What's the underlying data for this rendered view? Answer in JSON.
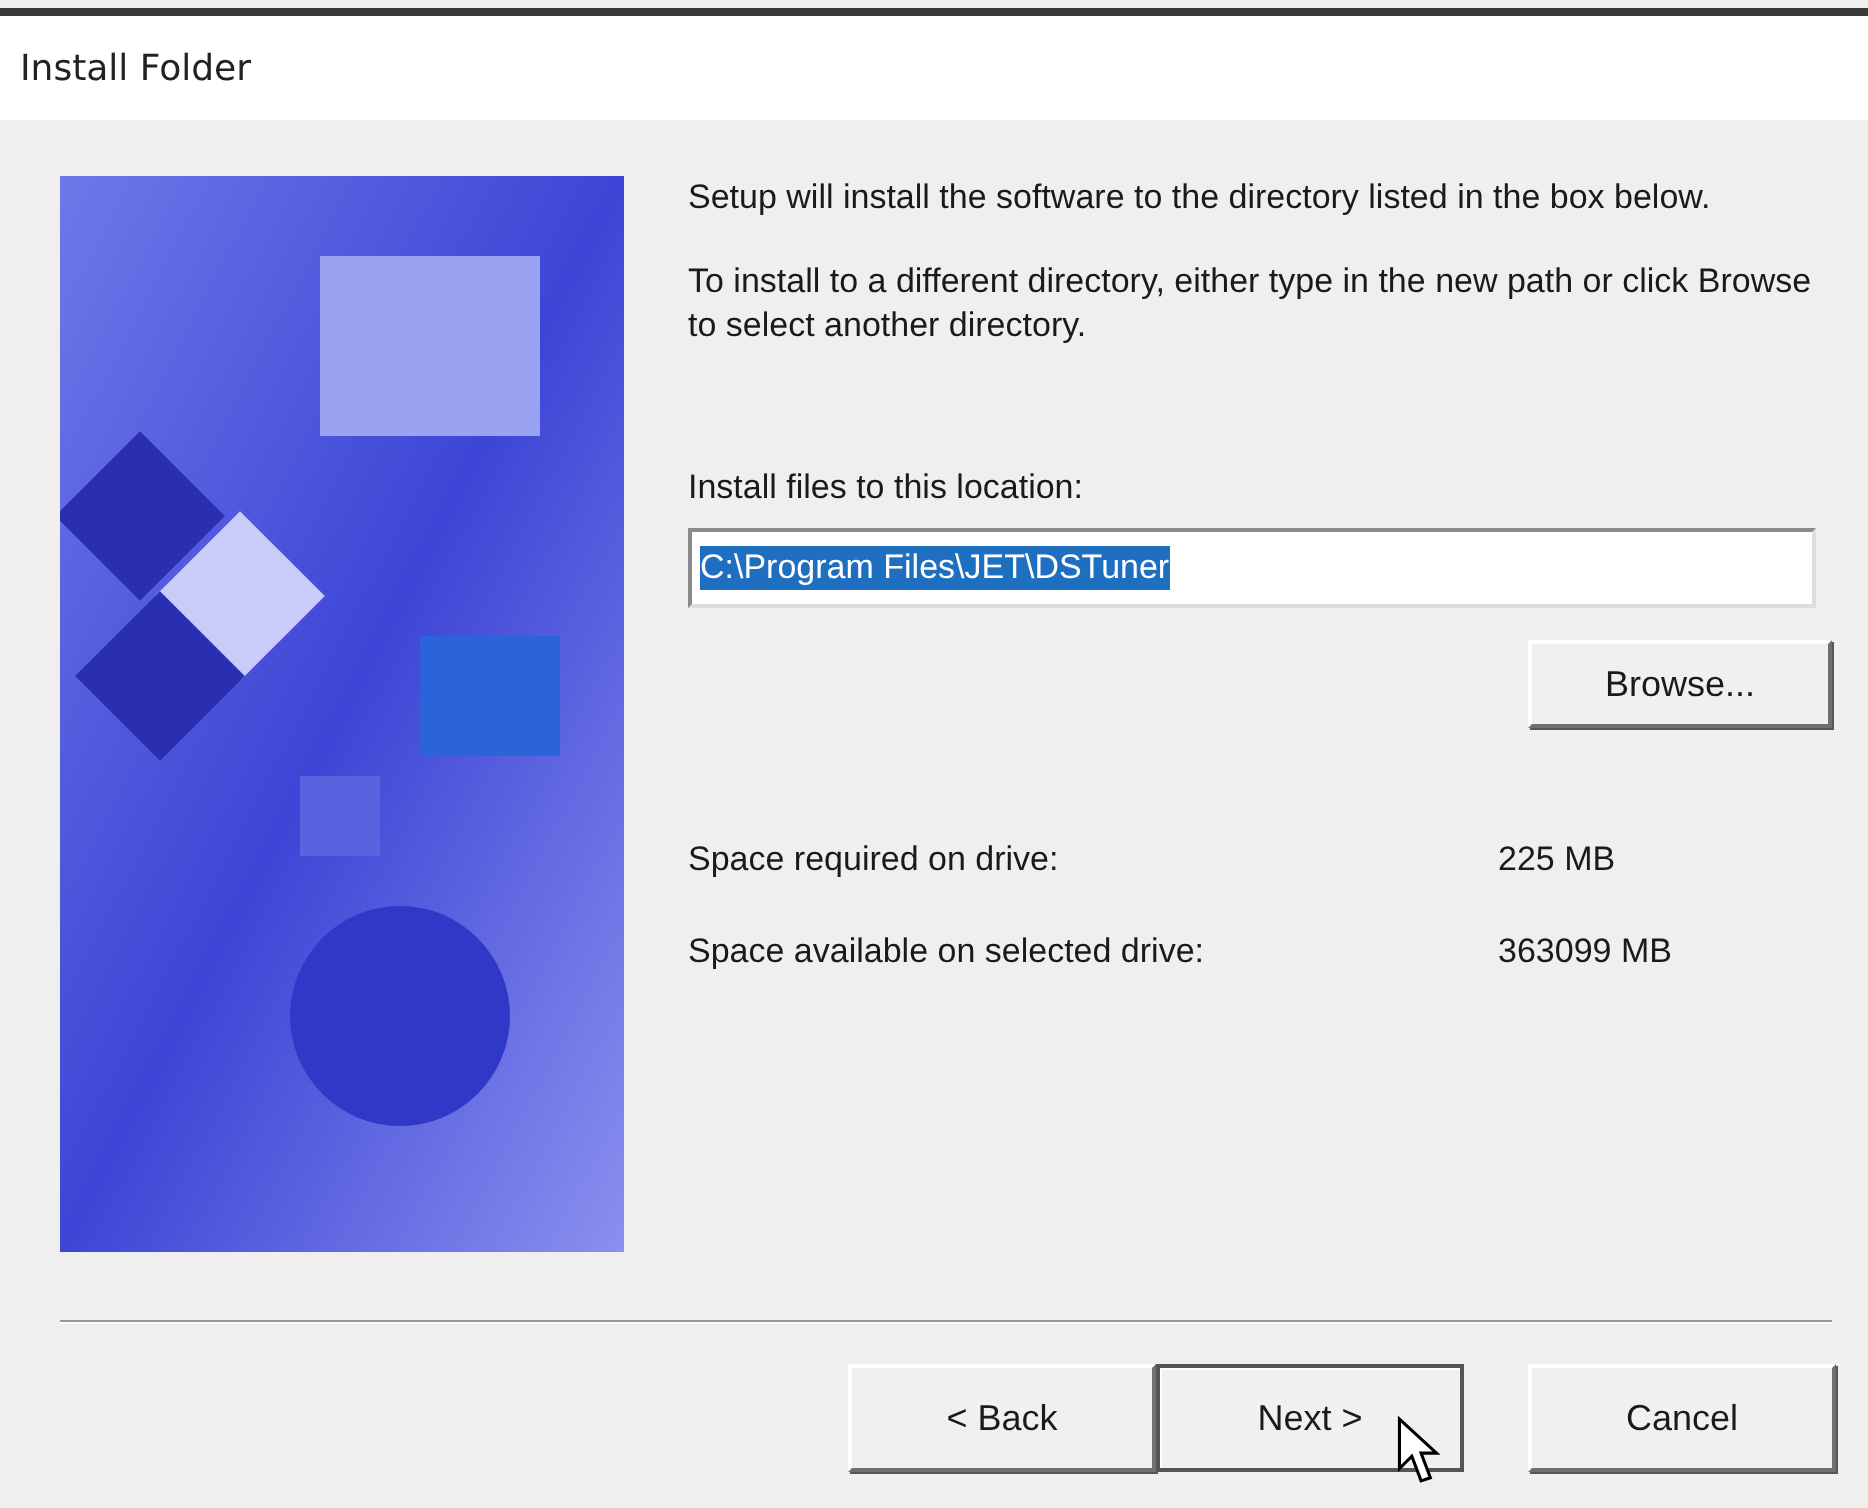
{
  "window": {
    "title": "Install Folder"
  },
  "paragraphs": [
    "Setup will install the software to the directory listed in the box below.",
    "To install to a different directory, either type in the new path or click Browse to select another directory."
  ],
  "location": {
    "label": "Install files to this location:",
    "value": "C:\\Program Files\\JET\\DSTuner",
    "selected": true
  },
  "browse_button": "Browse...",
  "space": [
    {
      "label": "Space required on drive:",
      "value": "225 MB"
    },
    {
      "label": "Space available on selected drive:",
      "value": "363099 MB"
    }
  ],
  "buttons": [
    {
      "label": "< Back",
      "default": false
    },
    {
      "label": "Next >",
      "default": true
    },
    {
      "label": "Cancel",
      "default": false
    }
  ]
}
